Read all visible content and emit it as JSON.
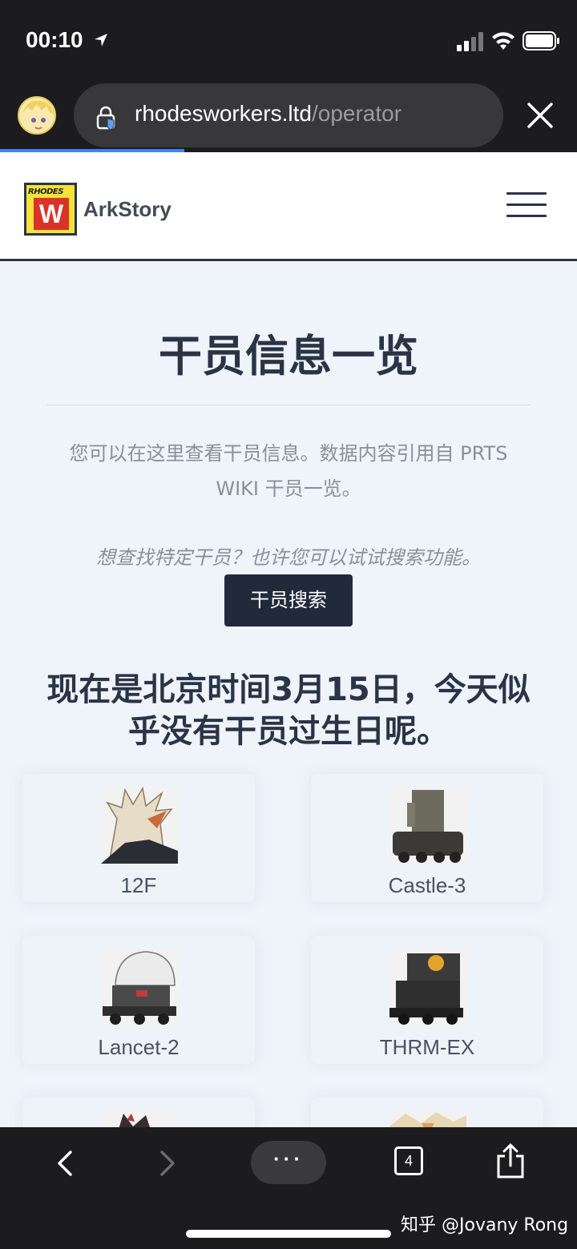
{
  "status": {
    "time": "00:10"
  },
  "browser": {
    "url_domain": "rhodesworkers.ltd",
    "url_path": "/operator",
    "load_progress": 0.32,
    "toolbar": {
      "tab_count": "4",
      "more_label": "···"
    }
  },
  "site": {
    "logo_small_text": "RHODES",
    "logo_letter": "W",
    "brand": "ArkStory",
    "title": "干员信息一览",
    "description": "您可以在这里查看干员信息。数据内容引用自 PRTS WIKI 干员一览。",
    "search_hint": "想查找特定干员？也许您可以试试搜索功能。",
    "search_button": "干员搜索",
    "birthday_notice": "现在是北京时间3月15日，今天似乎没有干员过生日呢。",
    "operators": [
      {
        "name": "12F"
      },
      {
        "name": "Castle-3"
      },
      {
        "name": "Lancet-2"
      },
      {
        "name": "THRM-EX"
      },
      {
        "name": ""
      },
      {
        "name": ""
      }
    ]
  },
  "watermark": "知乎 @Jovany Rong",
  "colors": {
    "accent": "#212a3b",
    "progress": "#3f83f8",
    "page_bg": "#eff3fa"
  }
}
